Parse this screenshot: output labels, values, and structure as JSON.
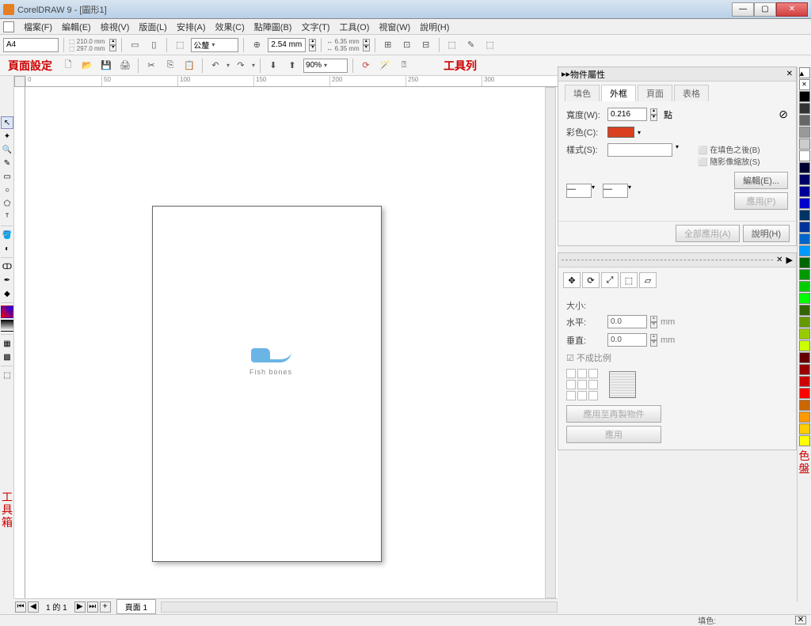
{
  "app": {
    "title": "CorelDRAW 9 - [圖形1]"
  },
  "menu": [
    "檔案(F)",
    "編輯(E)",
    "檢視(V)",
    "版面(L)",
    "安排(A)",
    "效果(C)",
    "點陣圖(B)",
    "文字(T)",
    "工具(O)",
    "視窗(W)",
    "說明(H)"
  ],
  "row1": {
    "pagesize": "A4",
    "width": "210.0 mm",
    "height": "297.0 mm",
    "units": "公釐",
    "nudge": "2.54 mm",
    "snapx": "6.35 mm",
    "snapy": "6.35 mm"
  },
  "row2": {
    "label_left": "頁面設定",
    "zoom": "90%",
    "label_right": "工具列"
  },
  "ruler_h": [
    "0",
    "50",
    "100",
    "150",
    "200",
    "250",
    "300"
  ],
  "canvas": {
    "fish_text": "Fish bones"
  },
  "page_nav": {
    "info": "1 的 1",
    "tab": "頁面 1"
  },
  "docker1": {
    "title": "物件屬性",
    "tabs": [
      "填色",
      "外框",
      "頁面",
      "表格"
    ],
    "active_tab": 1,
    "width_label": "寬度(W):",
    "width_val": "0.216",
    "width_unit": "點",
    "color_label": "彩色(C):",
    "style_label": "樣式(S):",
    "behind_fill": "在填色之後(B)",
    "scale": "隨影像縮放(S)",
    "edit_btn": "編輯(E)...",
    "apply_btn": "應用(P)",
    "apply_all": "全部應用(A)",
    "help": "說明(H)"
  },
  "docker2": {
    "size_label": "大小:",
    "h_label": "水平:",
    "v_label": "垂直:",
    "h_val": "0.0",
    "v_val": "0.0",
    "unit": "mm",
    "prop_cb": "不成比例",
    "dup_btn": "應用至再製物件",
    "apply_btn": "應用"
  },
  "toolbox_label": [
    "工",
    "具",
    "箱"
  ],
  "palette_label": [
    "色",
    "盤"
  ],
  "palette_colors": [
    "",
    "#000",
    "#333",
    "#666",
    "#999",
    "#ccc",
    "#fff",
    "#003",
    "#006",
    "#009",
    "#00c",
    "#036",
    "#039",
    "#06c",
    "#09f",
    "#060",
    "#090",
    "#0c0",
    "#0f0",
    "#360",
    "#690",
    "#9c0",
    "#cf0",
    "#600",
    "#900",
    "#c00",
    "#f00",
    "#c60",
    "#f90",
    "#fc0",
    "#ff0"
  ],
  "status": {
    "fill": "填色:"
  }
}
